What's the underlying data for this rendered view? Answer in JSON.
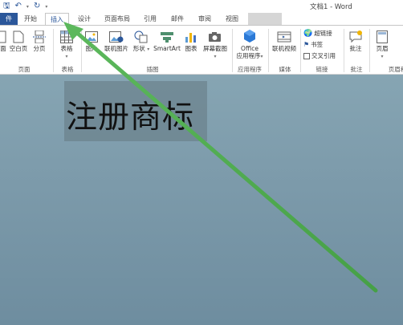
{
  "window": {
    "title": "文档1 - Word"
  },
  "tabs": [
    {
      "label": "件"
    },
    {
      "label": "开始"
    },
    {
      "label": "插入"
    },
    {
      "label": "设计"
    },
    {
      "label": "页面布局"
    },
    {
      "label": "引用"
    },
    {
      "label": "邮件"
    },
    {
      "label": "审阅"
    },
    {
      "label": "视图"
    }
  ],
  "ribbon": {
    "pages": {
      "cover": "面",
      "blank": "空白页",
      "break": "分页",
      "group": "页面"
    },
    "tables": {
      "table": "表格",
      "group": "表格"
    },
    "illustrations": {
      "picture": "图片",
      "online_picture": "联机图片",
      "shapes": "形状",
      "smartart": "SmartArt",
      "chart": "图表",
      "screenshot": "屏幕截图",
      "group": "插图"
    },
    "apps": {
      "office": "Office",
      "apps_label": "应用程序",
      "group": "应用程序"
    },
    "media": {
      "online_video": "联机视频",
      "group": "媒体"
    },
    "links": {
      "hyperlink": "超链接",
      "bookmark": "书签",
      "crossref": "交叉引用",
      "group": "链接"
    },
    "comments": {
      "comment": "批注",
      "group": "批注"
    },
    "header": {
      "header": "页眉",
      "group": "页眉和"
    }
  },
  "document": {
    "wordart_text": "注册商标"
  },
  "colors": {
    "accent": "#2b579a",
    "arrow": "#5cb85c",
    "canvas": "#7d9bab"
  }
}
